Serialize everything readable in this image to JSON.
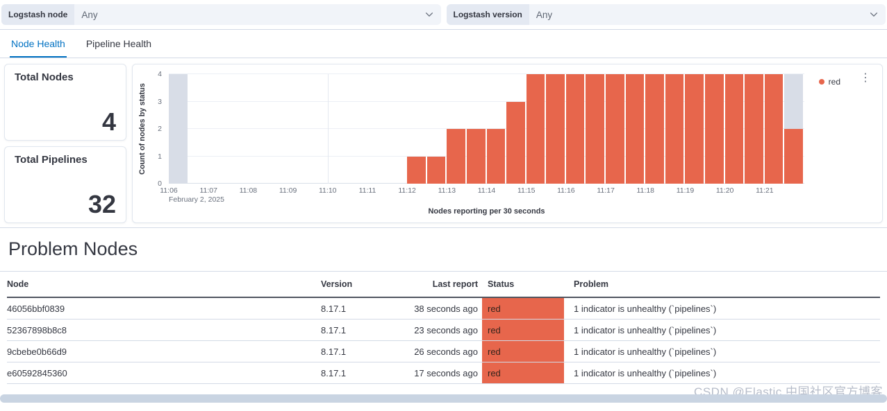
{
  "filters": {
    "node": {
      "label": "Logstash node",
      "value": "Any"
    },
    "version": {
      "label": "Logstash version",
      "value": "Any"
    }
  },
  "tabs": [
    {
      "label": "Node Health",
      "active": true
    },
    {
      "label": "Pipeline Health",
      "active": false
    }
  ],
  "stats": [
    {
      "title": "Total Nodes",
      "value": "4"
    },
    {
      "title": "Total Pipelines",
      "value": "32"
    }
  ],
  "chart_data": {
    "type": "bar",
    "title": "",
    "xlabel": "Nodes reporting per 30 seconds",
    "ylabel": "Count of nodes by status",
    "ylim": [
      0,
      4
    ],
    "y_ticks": [
      0,
      1,
      2,
      3,
      4
    ],
    "bucket_seconds": 30,
    "slots_per_label": 2,
    "x_tick_labels": [
      "11:06",
      "11:07",
      "11:08",
      "11:09",
      "11:10",
      "11:11",
      "11:12",
      "11:13",
      "11:14",
      "11:15",
      "11:16",
      "11:17",
      "11:18",
      "11:19",
      "11:20",
      "11:21"
    ],
    "x_date_label": "February 2, 2025",
    "v_gridlines_at_labels": [
      "11:10",
      "11:15",
      "11:20"
    ],
    "series": [
      {
        "name": "red",
        "color": "#e7664c",
        "values": [
          0,
          0,
          0,
          0,
          0,
          0,
          0,
          0,
          0,
          0,
          0,
          0,
          1,
          1,
          2,
          2,
          2,
          3,
          4,
          4,
          4,
          4,
          4,
          4,
          4,
          4,
          4,
          4,
          4,
          4,
          4,
          2
        ]
      }
    ],
    "partial_bucket_indices": [
      0,
      31
    ],
    "partial_bucket_color": "#d8dde7",
    "legend": {
      "position": "right",
      "items": [
        {
          "label": "red",
          "color": "#e7664c"
        }
      ]
    }
  },
  "problem_nodes": {
    "title": "Problem Nodes",
    "columns": [
      "Node",
      "Version",
      "Last report",
      "Status",
      "Problem"
    ],
    "status_color": "#e7664c",
    "rows": [
      {
        "node": "46056bbf0839",
        "version": "8.17.1",
        "last_report": "38 seconds ago",
        "status": "red",
        "problem": "1 indicator is unhealthy (`pipelines`)"
      },
      {
        "node": "52367898b8c8",
        "version": "8.17.1",
        "last_report": "23 seconds ago",
        "status": "red",
        "problem": "1 indicator is unhealthy (`pipelines`)"
      },
      {
        "node": "9cbebe0b66d9",
        "version": "8.17.1",
        "last_report": "26 seconds ago",
        "status": "red",
        "problem": "1 indicator is unhealthy (`pipelines`)"
      },
      {
        "node": "e60592845360",
        "version": "8.17.1",
        "last_report": "17 seconds ago",
        "status": "red",
        "problem": "1 indicator is unhealthy (`pipelines`)"
      }
    ]
  },
  "watermark": "CSDN @Elastic 中国社区官方博客",
  "colors": {
    "accent_blue": "#0071c2",
    "bar_red": "#e7664c",
    "border": "#d3dae6"
  }
}
